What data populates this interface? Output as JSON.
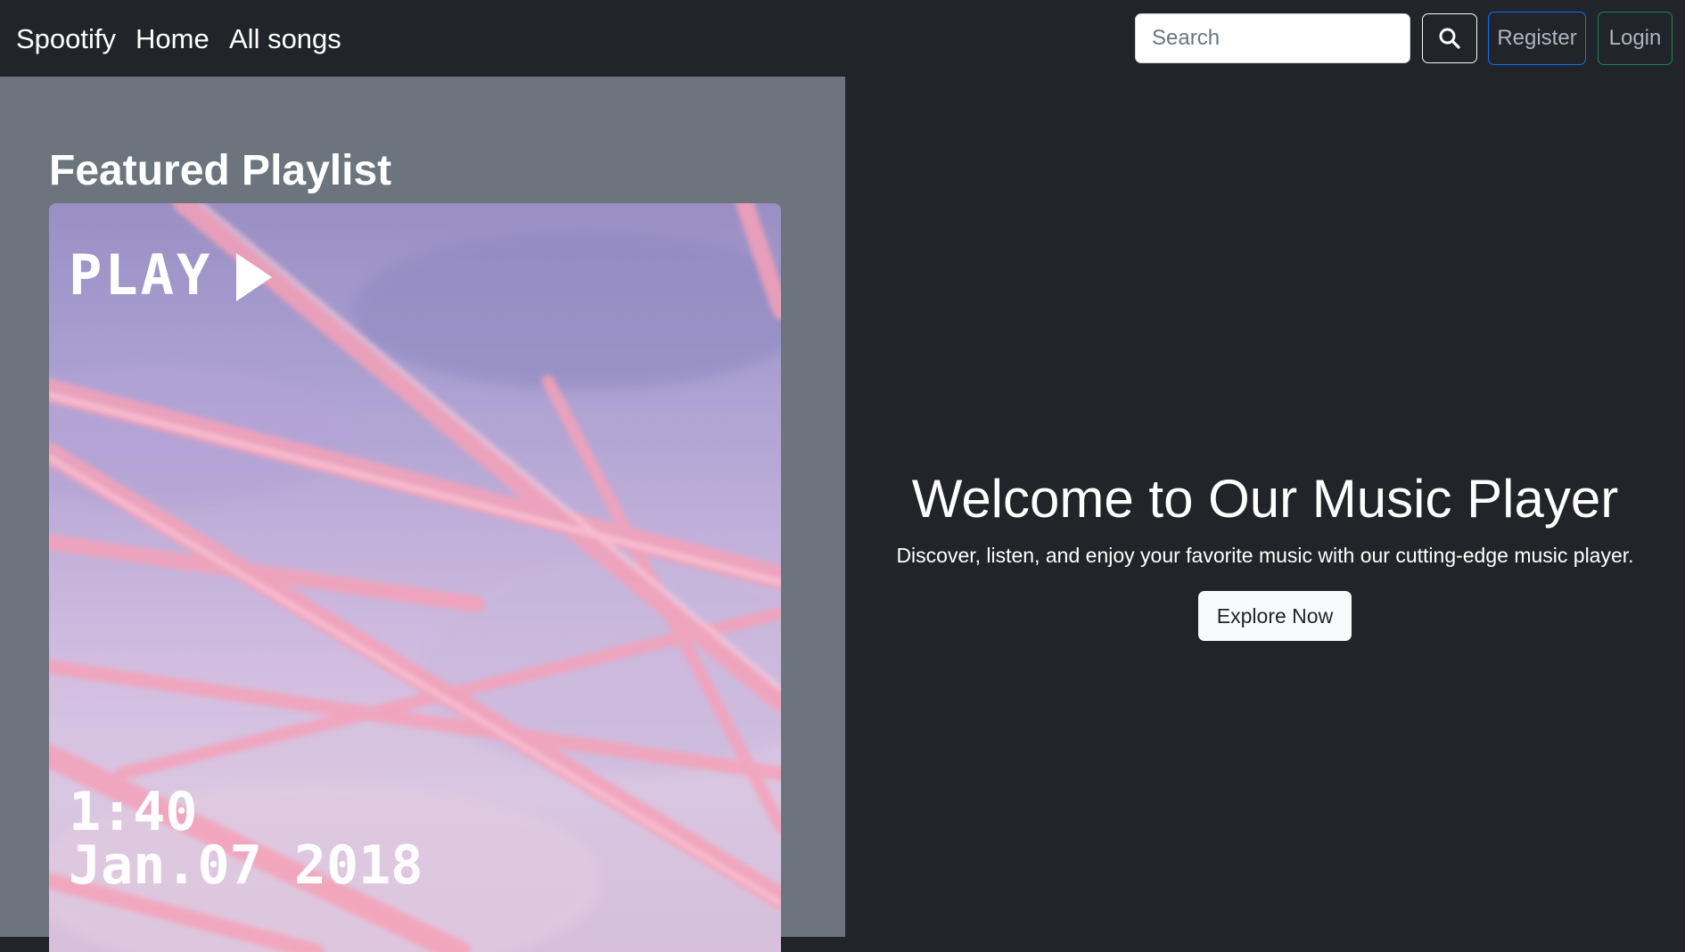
{
  "navbar": {
    "brand": "Spootify",
    "links": [
      {
        "label": "Home"
      },
      {
        "label": "All songs"
      }
    ],
    "search": {
      "placeholder": "Search",
      "value": ""
    },
    "search_icon": "search-icon",
    "register_label": "Register",
    "login_label": "Login"
  },
  "featured": {
    "title": "Featured Playlist",
    "cover": {
      "play_text": "PLAY",
      "time": "1:40",
      "date": "Jan.07 2018"
    }
  },
  "hero": {
    "title": "Welcome to Our Music Player",
    "subtitle": "Discover, listen, and enjoy your favorite music with our cutting-edge music player.",
    "cta_label": "Explore Now"
  },
  "colors": {
    "background": "#212529",
    "left_panel": "#6c757d",
    "register_border": "#0d6efd",
    "login_border": "#198754"
  }
}
